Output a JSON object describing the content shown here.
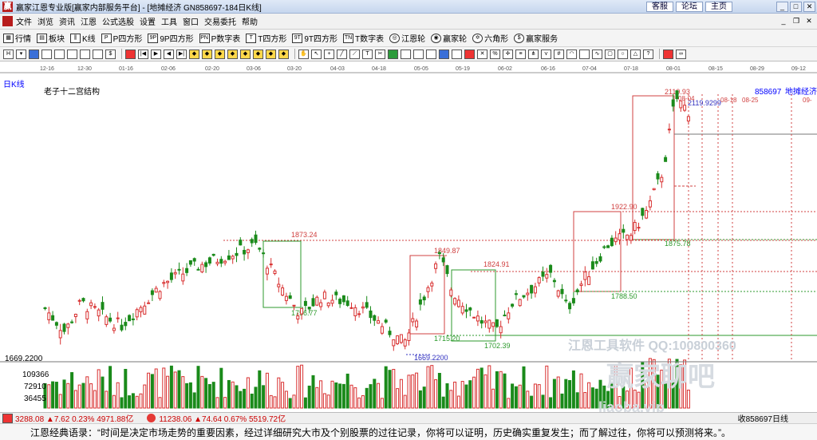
{
  "window": {
    "title": "赢家江恩专业版[赢家内部服务平台] - [地摊经济  GN858697-184日K线]",
    "links": [
      "客服",
      "论坛",
      "主页"
    ]
  },
  "menu": [
    "文件",
    "浏览",
    "资讯",
    "江恩",
    "公式选股",
    "设置",
    "工具",
    "窗口",
    "交易委托",
    "帮助"
  ],
  "toolbar": [
    "行情",
    "板块",
    "K线",
    "P四方形",
    "9P四方形",
    "P数字表",
    "T四方形",
    "9T四方形",
    "T数字表",
    "江恩轮",
    "赢家轮",
    "六角形",
    "赢家服务"
  ],
  "chart": {
    "period_label": "日K线",
    "study_name": "老子十二宫结构",
    "code": "858697",
    "name": "地摊经济",
    "top_dates": [
      "12-16",
      "12-30",
      "01-16",
      "02-06",
      "02-20",
      "03-06",
      "03-20",
      "04-03",
      "04-18",
      "05-05",
      "05-19",
      "06-02",
      "06-16",
      "07-04",
      "07-18",
      "08-01",
      "08-15",
      "08-29",
      "09-12"
    ],
    "future_dates": [
      "08-04",
      "08-18",
      "08-25",
      "09-"
    ],
    "last_price": "2119.9299",
    "high_label": "2119.93",
    "low_axis": "1669.2200",
    "vol_ticks": [
      "109366",
      "72910",
      "36455"
    ],
    "annotations": [
      "1873.24",
      "1756.77",
      "1849.87",
      "1824.91",
      "1715.20",
      "1702.39",
      "1669.2200",
      "1922.90",
      "1875.78",
      "1788.50"
    ],
    "watermark_text": "江恩工具软件   QQ:100800360",
    "watermark_logo": "赢家聊吧",
    "watermark_url": "liaoba.vip"
  },
  "chart_data": {
    "type": "candlestick",
    "title": "老子十二宫结构",
    "y_reference": {
      "high": 2119.93,
      "low": 1669.22
    },
    "highlighted_levels": [
      1873.24,
      1756.77,
      1849.87,
      1824.91,
      1715.2,
      1702.39,
      1669.22,
      1922.9,
      1875.78,
      1788.5,
      2119.93
    ],
    "volume_ticks": [
      109366,
      72910,
      36455
    ]
  },
  "status": {
    "idx1": "3288.08 ▲7.62 0.23% 4971.88亿",
    "idx2": "11238.06 ▲74.64 0.67% 5519.72亿",
    "right": "收858697日线"
  },
  "quote": "江恩经典语录：“时间是决定市场走势的重要因素，经过详细研究大市及个别股票的过往记录，你将可以证明，历史确实重复发生；而了解过往，你将可以预测将来。”。"
}
